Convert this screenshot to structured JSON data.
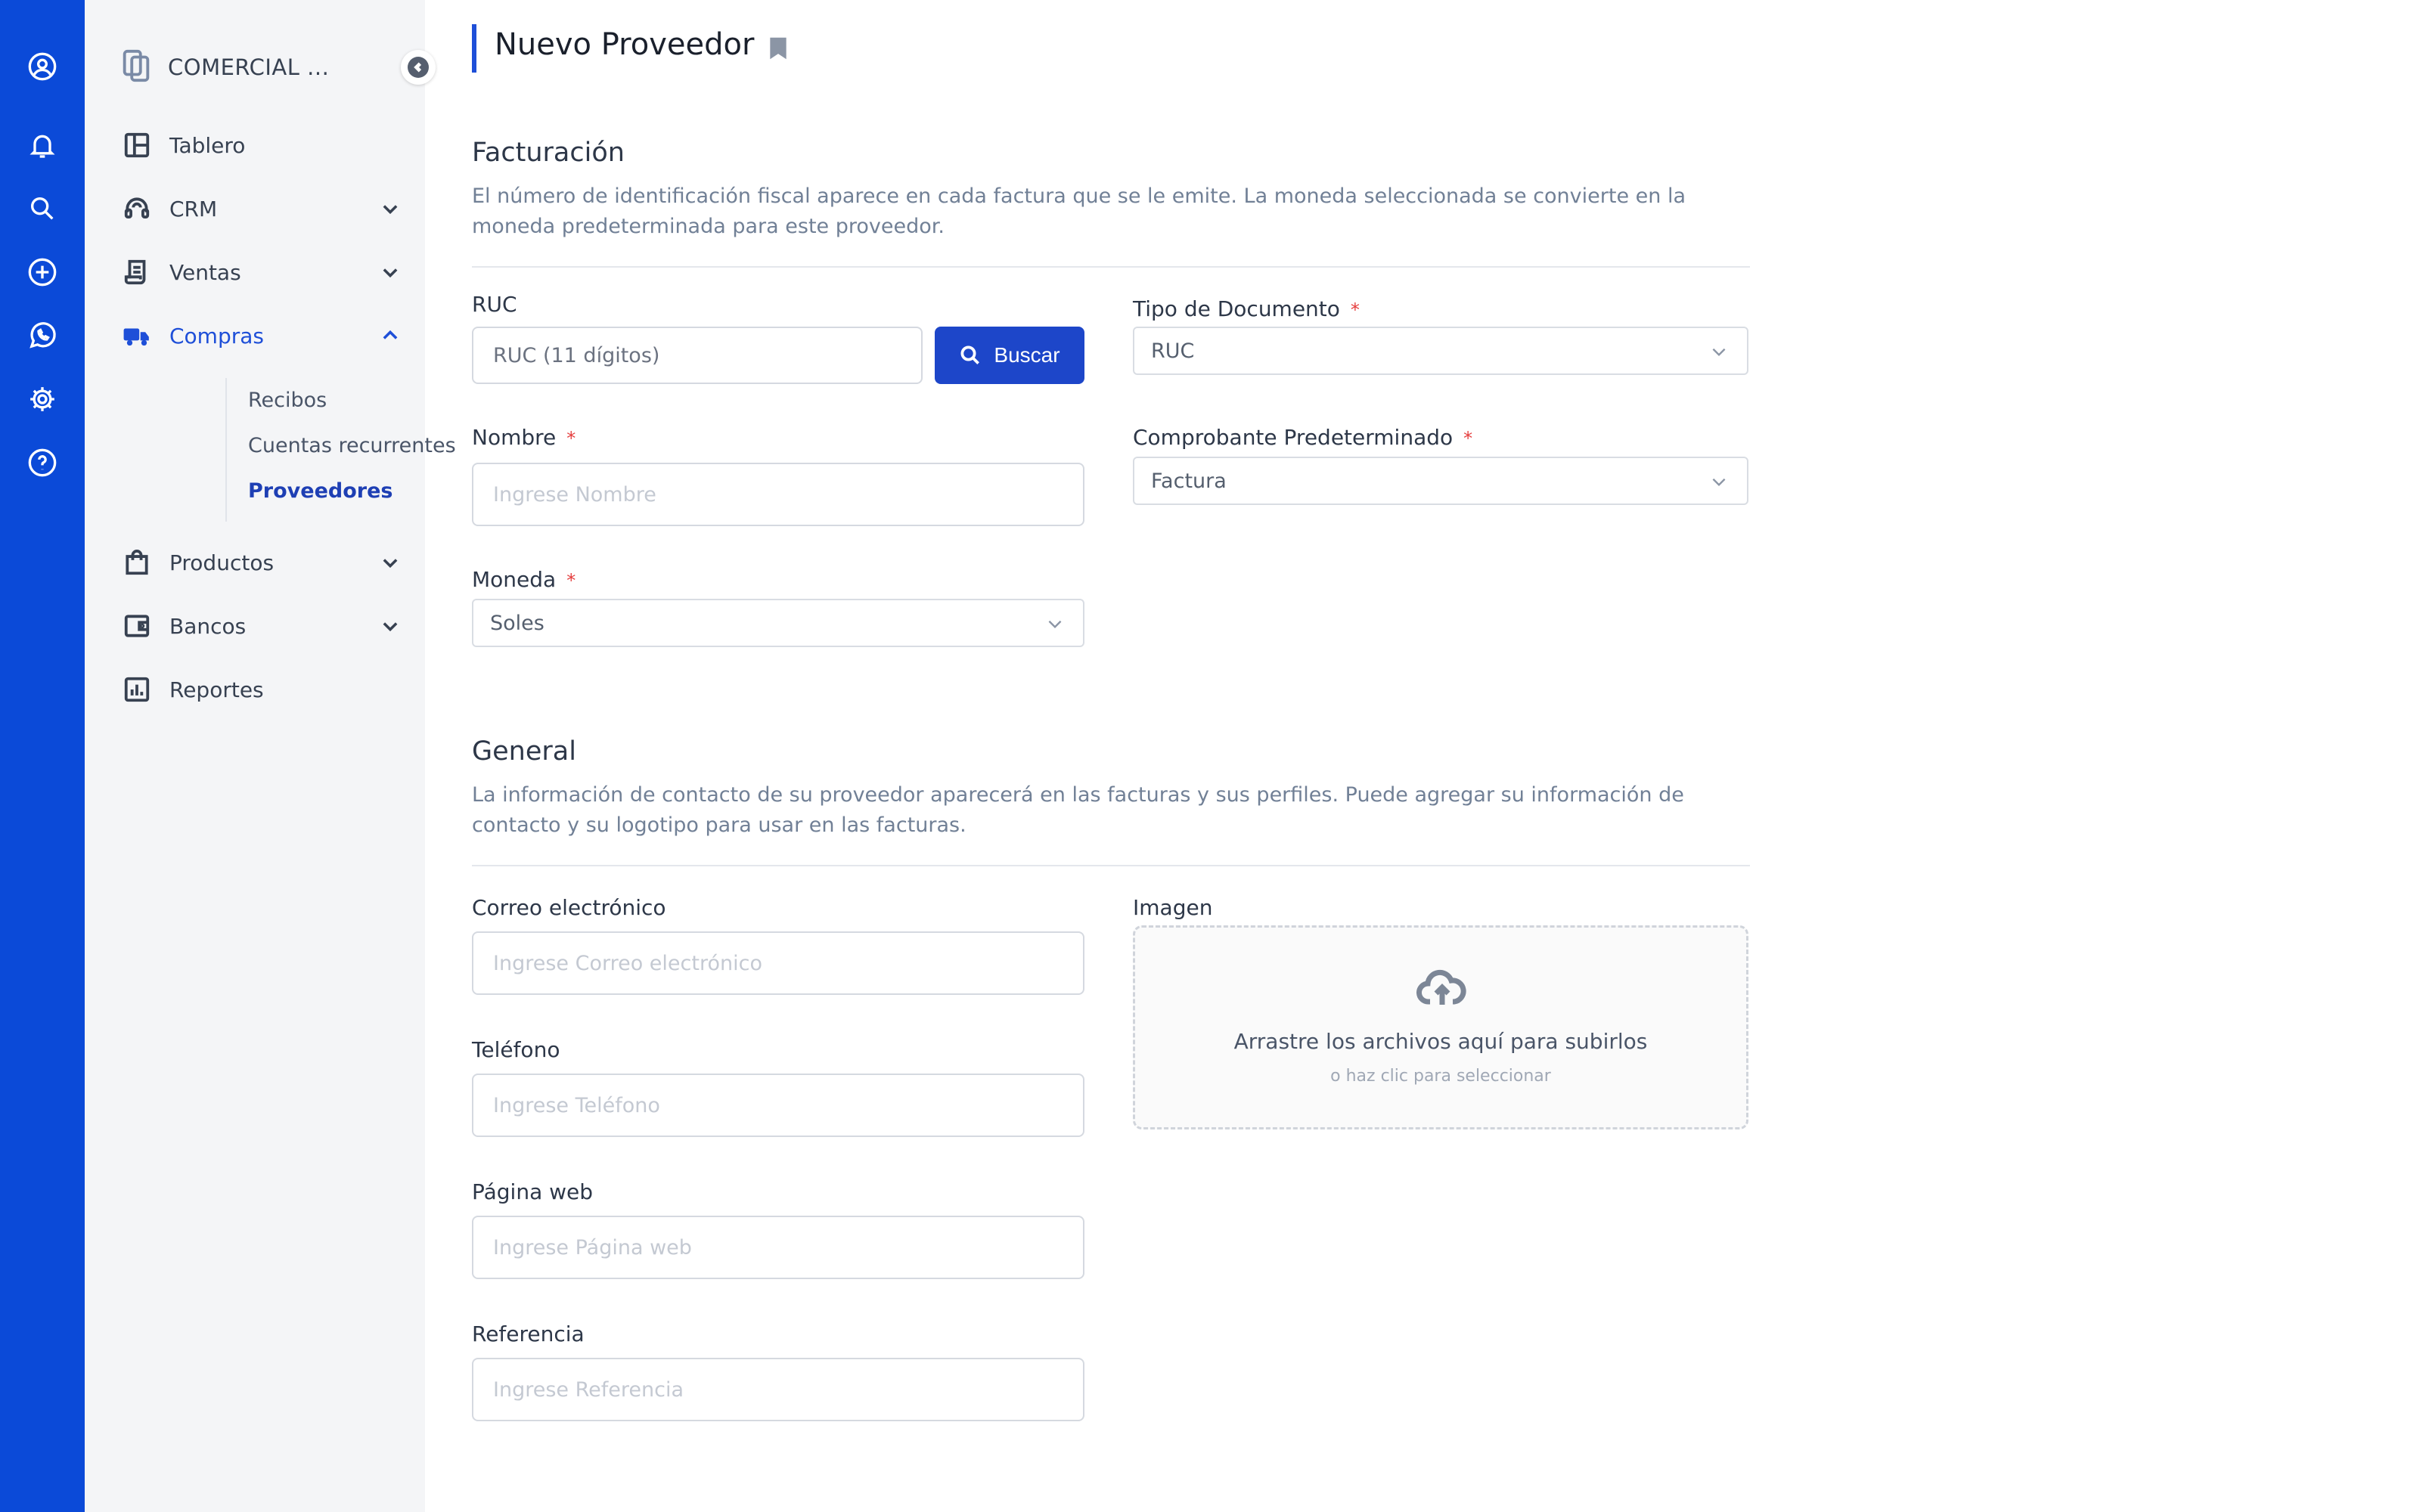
{
  "rail": {
    "icons": [
      "user-circle-icon",
      "bell-icon",
      "search-icon",
      "plus-circle-icon",
      "whatsapp-icon",
      "gear-icon",
      "help-icon"
    ]
  },
  "sidebar": {
    "company": "COMERCIAL ...",
    "items": [
      {
        "label": "Tablero",
        "icon": "dashboard-icon"
      },
      {
        "label": "CRM",
        "icon": "headset-icon"
      },
      {
        "label": "Ventas",
        "icon": "receipt-icon"
      },
      {
        "label": "Compras",
        "icon": "truck-icon"
      },
      {
        "label": "Productos",
        "icon": "shopping-bag-icon"
      },
      {
        "label": "Bancos",
        "icon": "wallet-icon"
      },
      {
        "label": "Reportes",
        "icon": "chart-icon"
      }
    ],
    "sub_items": [
      "Recibos",
      "Cuentas recurrentes",
      "Proveedores"
    ],
    "active_color": "#1e4fd8"
  },
  "page": {
    "title": "Nuevo Proveedor"
  },
  "billing": {
    "title": "Facturación",
    "description": "El número de identificación fiscal aparece en cada factura que se le emite. La moneda seleccionada se convierte en la moneda predeterminada para este proveedor.",
    "ruc_label": "RUC",
    "ruc_placeholder": "RUC (11 dígitos)",
    "search_button": "Buscar",
    "doc_type_label": "Tipo de Documento",
    "doc_type_value": "RUC",
    "name_label": "Nombre",
    "name_placeholder": "Ingrese Nombre",
    "voucher_label": "Comprobante Predeterminado",
    "voucher_value": "Factura",
    "currency_label": "Moneda",
    "currency_value": "Soles",
    "required_mark": "*"
  },
  "general": {
    "title": "General",
    "description": "La información de contacto de su proveedor aparecerá en las facturas y sus perfiles. Puede agregar su información de contacto y su logotipo para usar en las facturas.",
    "email_label": "Correo electrónico",
    "email_placeholder": "Ingrese Correo electrónico",
    "phone_label": "Teléfono",
    "phone_placeholder": "Ingrese Teléfono",
    "web_label": "Página web",
    "web_placeholder": "Ingrese Página web",
    "ref_label": "Referencia",
    "ref_placeholder": "Ingrese Referencia",
    "image_label": "Imagen",
    "dropzone_title": "Arrastre los archivos aquí para subirlos",
    "dropzone_sub": "o haz clic para seleccionar"
  },
  "colors": {
    "rail": "#0b4ad8",
    "primary_button": "#1d46c9",
    "required": "#e53e3e"
  }
}
